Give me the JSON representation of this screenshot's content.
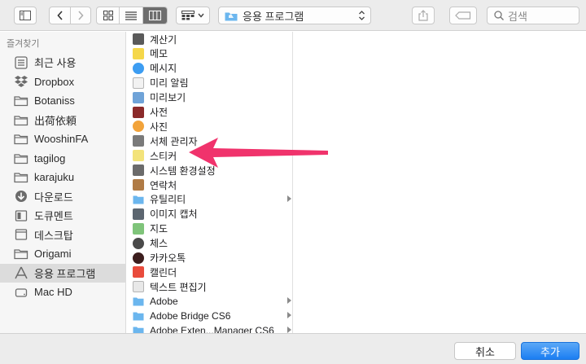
{
  "toolbar": {
    "path_popup_label": "응용 프로그램",
    "search_placeholder": "검색"
  },
  "sidebar": {
    "header": "즐겨찾기",
    "items": [
      {
        "label": "최근 사용",
        "icon": "recents-icon",
        "selected": false
      },
      {
        "label": "Dropbox",
        "icon": "dropbox-icon",
        "selected": false
      },
      {
        "label": "Botaniss",
        "icon": "folder-icon",
        "selected": false
      },
      {
        "label": "出荷依頼",
        "icon": "folder-icon",
        "selected": false
      },
      {
        "label": "WooshinFA",
        "icon": "folder-icon",
        "selected": false
      },
      {
        "label": "tagilog",
        "icon": "folder-icon",
        "selected": false
      },
      {
        "label": "karajuku",
        "icon": "folder-icon",
        "selected": false
      },
      {
        "label": "다운로드",
        "icon": "downloads-icon",
        "selected": false
      },
      {
        "label": "도큐멘트",
        "icon": "documents-icon",
        "selected": false
      },
      {
        "label": "데스크탑",
        "icon": "desktop-icon",
        "selected": false
      },
      {
        "label": "Origami",
        "icon": "folder-icon",
        "selected": false
      },
      {
        "label": "응용 프로그램",
        "icon": "applications-icon",
        "selected": true
      },
      {
        "label": "Mac HD",
        "icon": "harddisk-icon",
        "selected": false
      }
    ]
  },
  "column1": {
    "items": [
      {
        "label": "계산기",
        "icon": "calculator-icon",
        "color": "#5a5a5a",
        "has_children": false
      },
      {
        "label": "메모",
        "icon": "notes-icon",
        "color": "#f5d74a",
        "has_children": false
      },
      {
        "label": "메시지",
        "icon": "messages-icon",
        "color": "#3d9df2",
        "has_children": false
      },
      {
        "label": "미리 알림",
        "icon": "reminders-icon",
        "color": "#f2f2f2",
        "has_children": false
      },
      {
        "label": "미리보기",
        "icon": "preview-icon",
        "color": "#6fa3d8",
        "has_children": false
      },
      {
        "label": "사전",
        "icon": "dictionary-icon",
        "color": "#8b2a2a",
        "has_children": false
      },
      {
        "label": "사진",
        "icon": "photos-icon",
        "color": "#f2a33a",
        "has_children": false
      },
      {
        "label": "서체 관리자",
        "icon": "fontbook-icon",
        "color": "#7a7a7a",
        "has_children": false
      },
      {
        "label": "스티커",
        "icon": "stickies-icon",
        "color": "#f3e37a",
        "has_children": false
      },
      {
        "label": "시스템 환경설정",
        "icon": "system-preferences-icon",
        "color": "#6b6b6b",
        "has_children": false
      },
      {
        "label": "연락처",
        "icon": "contacts-icon",
        "color": "#b07b45",
        "has_children": false
      },
      {
        "label": "유틸리티",
        "icon": "utilities-folder-icon",
        "color": "#6bb6ee",
        "has_children": true
      },
      {
        "label": "이미지 캡처",
        "icon": "image-capture-icon",
        "color": "#5c6670",
        "has_children": false
      },
      {
        "label": "지도",
        "icon": "maps-icon",
        "color": "#7fc47a",
        "has_children": false
      },
      {
        "label": "체스",
        "icon": "chess-icon",
        "color": "#4a4a4a",
        "has_children": false
      },
      {
        "label": "카카오톡",
        "icon": "kakaotalk-icon",
        "color": "#3c1e1e",
        "has_children": false
      },
      {
        "label": "캘린더",
        "icon": "calendar-icon",
        "color": "#e94b3c",
        "has_children": false
      },
      {
        "label": "텍스트 편집기",
        "icon": "textedit-icon",
        "color": "#e8e8e8",
        "has_children": false
      },
      {
        "label": "Adobe",
        "icon": "folder-icon",
        "color": "#6bb6ee",
        "has_children": true
      },
      {
        "label": "Adobe Bridge CS6",
        "icon": "folder-icon",
        "color": "#6bb6ee",
        "has_children": true
      },
      {
        "label": "Adobe Exten...Manager CS6",
        "icon": "folder-icon",
        "color": "#6bb6ee",
        "has_children": true
      }
    ]
  },
  "annotation": {
    "color": "#f0336c",
    "points_to": "스티커"
  },
  "footer": {
    "cancel_label": "취소",
    "add_label": "추가"
  },
  "colors": {
    "accent": "#1b7ef2",
    "sidebar_folder": "#6b6b6b"
  }
}
